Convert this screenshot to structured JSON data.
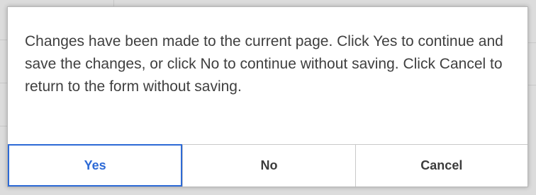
{
  "dialog": {
    "message": "Changes have been made to the current page. Click Yes to continue and save the changes, or click No to continue without saving. Click Cancel to return to the form without saving.",
    "buttons": {
      "yes": "Yes",
      "no": "No",
      "cancel": "Cancel"
    },
    "accent_color": "#2d6ad6"
  }
}
